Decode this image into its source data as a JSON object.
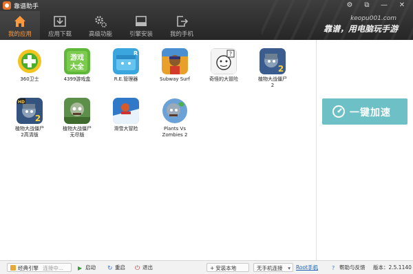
{
  "window": {
    "title": "靠谱助手",
    "controls": {
      "settings": "⚙",
      "restore": "⧉",
      "minimize": "—",
      "close": "✕"
    }
  },
  "nav": {
    "tabs": [
      {
        "label": "我的应用",
        "icon": "home-icon",
        "active": true
      },
      {
        "label": "应用下载",
        "icon": "download-icon",
        "active": false
      },
      {
        "label": "高级功能",
        "icon": "gears-icon",
        "active": false
      },
      {
        "label": "引擎安装",
        "icon": "drive-icon",
        "active": false
      },
      {
        "label": "我的手机",
        "icon": "export-phone-icon",
        "active": false
      }
    ]
  },
  "slogan": {
    "url": "keopu001.com",
    "text": "靠谱，用电脑玩手游"
  },
  "apps": [
    {
      "name": "360卫士",
      "icon": "360-guard-icon"
    },
    {
      "name": "4399游戏盒",
      "icon": "4399-game-box-icon"
    },
    {
      "name": "R.E.管理器",
      "icon": "re-manager-icon"
    },
    {
      "name": "Subway Surf",
      "icon": "subway-surf-icon"
    },
    {
      "name": "奇怪的大冒险",
      "icon": "weird-adventure-icon"
    },
    {
      "name": "植物大战僵尸\n2",
      "icon": "pvz2-icon"
    },
    {
      "name": "植物大战僵尸\n2高清版",
      "icon": "pvz2-hd-icon"
    },
    {
      "name": "植物大战僵尸\n无尽版",
      "icon": "pvz-endless-icon"
    },
    {
      "name": "滑雪大冒险",
      "icon": "ski-safari-icon"
    },
    {
      "name": "Plants Vs\nZombies 2",
      "icon": "pvz2-en-icon"
    }
  ],
  "side": {
    "accelerate_label": "一键加速"
  },
  "statusbar": {
    "engine_label": "经典引擎",
    "engine_status": "连接中...",
    "start_label": "启动",
    "restart_label": "重启",
    "exit_label": "退出",
    "install_apk_label": "安装本地APK",
    "phone_select": "无手机连接",
    "root_link": "Root手机",
    "help_label": "帮助与反馈",
    "version_label": "版本：",
    "version": "2.5.1140"
  },
  "colors": {
    "accent_orange": "#ff9a3c",
    "accelerate_teal": "#6cc0c6",
    "header_dark": "#2c2c2c"
  }
}
